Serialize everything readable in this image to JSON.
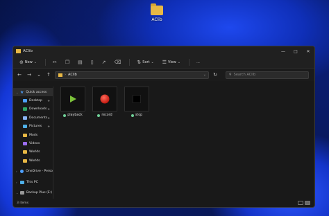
{
  "desktop": {
    "icon_label": "AClib"
  },
  "window": {
    "title": "AClib"
  },
  "toolbar": {
    "new_label": "New",
    "sort_label": "Sort",
    "view_label": "View",
    "more_label": "..."
  },
  "address": {
    "path": "AClib",
    "search_placeholder": "Search AClib"
  },
  "sidebar": {
    "items": [
      {
        "label": "Quick access"
      },
      {
        "label": "Desktop"
      },
      {
        "label": "Downloads"
      },
      {
        "label": "Documents"
      },
      {
        "label": "Pictures"
      },
      {
        "label": "Mods"
      },
      {
        "label": "Videos"
      },
      {
        "label": "Worlds"
      },
      {
        "label": "Worlds"
      },
      {
        "label": "OneDrive - Perso"
      },
      {
        "label": "This PC"
      },
      {
        "label": "Backup Plus (E:)"
      }
    ]
  },
  "files": [
    {
      "name": "playback"
    },
    {
      "name": "record"
    },
    {
      "name": "stop"
    }
  ],
  "status": {
    "count": "3 items"
  },
  "colors": {
    "play": "#7cc23a",
    "record": "#d12a1e",
    "stop": "#000000",
    "folder": "#e8b844",
    "synced": "#6fcf97"
  }
}
